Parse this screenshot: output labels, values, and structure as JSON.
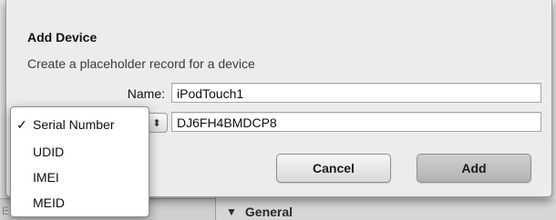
{
  "dialog": {
    "title": "Add Device",
    "subtitle": "Create a placeholder record for a device",
    "name_label": "Name:",
    "name_value": "iPodTouch1",
    "id_value": "DJ6FH4BMDCP8",
    "stepper_icon": "⬍",
    "cancel_label": "Cancel",
    "add_label": "Add"
  },
  "id_type_menu": {
    "selected": "Serial Number",
    "check_mark": "✓",
    "items": [
      {
        "label": "Serial Number"
      },
      {
        "label": "UDID"
      },
      {
        "label": "IMEI"
      },
      {
        "label": "MEID"
      }
    ]
  },
  "background": {
    "left_panel_text": "EMEA",
    "section_label": "General",
    "disclosure_icon": "▼"
  }
}
